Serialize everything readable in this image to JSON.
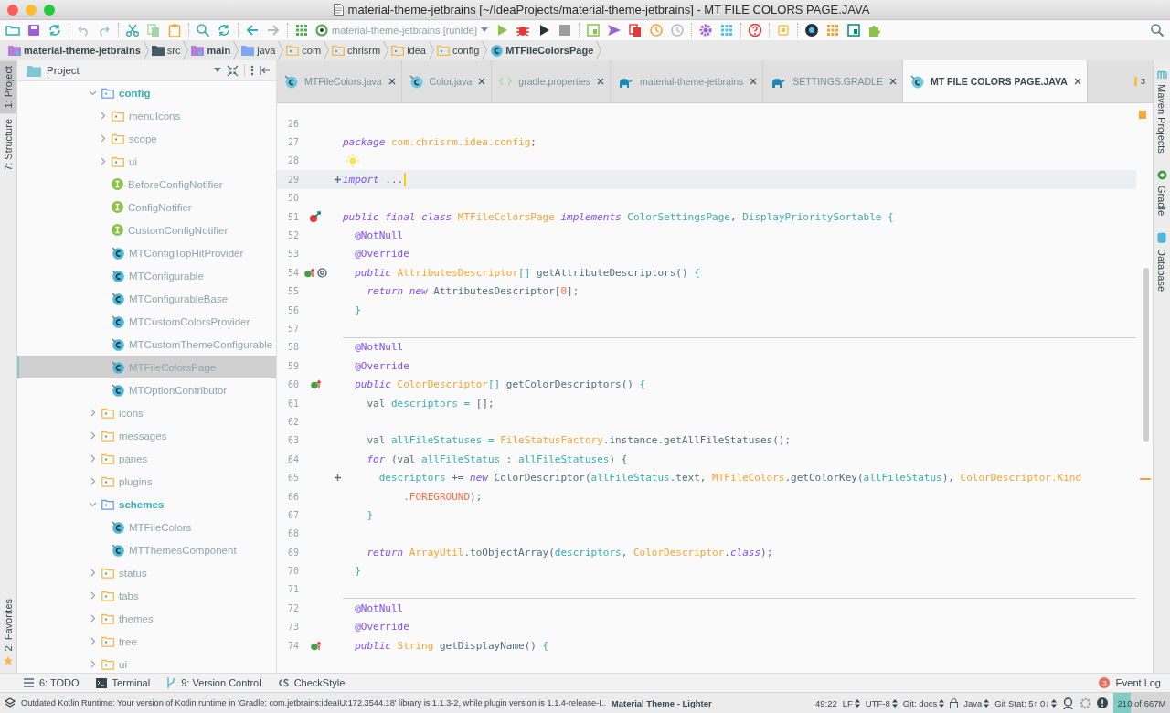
{
  "window": {
    "title": "material-theme-jetbrains [~/IdeaProjects/material-theme-jetbrains] - MT FILE COLORS PAGE.JAVA"
  },
  "toolbar": {
    "run_config": "material-theme-jetbrains [runIde]"
  },
  "breadcrumbs": [
    {
      "label": "material-theme-jetbrains",
      "kind": "module"
    },
    {
      "label": "src",
      "kind": "dir"
    },
    {
      "label": "main",
      "kind": "module"
    },
    {
      "label": "java",
      "kind": "source"
    },
    {
      "label": "com",
      "kind": "package"
    },
    {
      "label": "chrisrm",
      "kind": "package"
    },
    {
      "label": "idea",
      "kind": "package"
    },
    {
      "label": "config",
      "kind": "package"
    },
    {
      "label": "MTFileColorsPage",
      "kind": "class"
    }
  ],
  "left_tools_top": [
    {
      "label": "1: Project",
      "selected": true
    },
    {
      "label": "7: Structure",
      "selected": false
    }
  ],
  "left_tools_bottom": [
    {
      "label": "2: Favorites",
      "selected": false
    }
  ],
  "project_panel": {
    "title": "Project",
    "tree": [
      {
        "label": "config",
        "kind": "folder",
        "expanded": true,
        "selected": false,
        "children": [
          {
            "label": "menuIcons",
            "kind": "folder",
            "expanded": false,
            "selected": false
          },
          {
            "label": "scope",
            "kind": "folder",
            "expanded": false,
            "selected": false
          },
          {
            "label": "ui",
            "kind": "folder",
            "expanded": false,
            "selected": false
          },
          {
            "label": "BeforeConfigNotifier",
            "kind": "interface",
            "selected": false
          },
          {
            "label": "ConfigNotifier",
            "kind": "interface",
            "selected": false
          },
          {
            "label": "CustomConfigNotifier",
            "kind": "interface",
            "selected": false
          },
          {
            "label": "MTConfigTopHitProvider",
            "kind": "class",
            "selected": false
          },
          {
            "label": "MTConfigurable",
            "kind": "class",
            "selected": false
          },
          {
            "label": "MTConfigurableBase",
            "kind": "class",
            "selected": false
          },
          {
            "label": "MTCustomColorsProvider",
            "kind": "class",
            "selected": false
          },
          {
            "label": "MTCustomThemeConfigurable",
            "kind": "class",
            "selected": false
          },
          {
            "label": "MTFileColorsPage",
            "kind": "class",
            "selected": true
          },
          {
            "label": "MTOptionContributor",
            "kind": "class",
            "selected": false
          }
        ]
      },
      {
        "label": "icons",
        "kind": "folder",
        "expanded": false,
        "selected": false
      },
      {
        "label": "messages",
        "kind": "folder",
        "expanded": false,
        "selected": false
      },
      {
        "label": "panes",
        "kind": "folder",
        "expanded": false,
        "selected": false
      },
      {
        "label": "plugins",
        "kind": "folder",
        "expanded": false,
        "selected": false
      },
      {
        "label": "schemes",
        "kind": "folder",
        "expanded": true,
        "selected": false,
        "children": [
          {
            "label": "MTFileColors",
            "kind": "class",
            "selected": false
          },
          {
            "label": "MTThemesComponent",
            "kind": "class",
            "selected": false
          }
        ]
      },
      {
        "label": "status",
        "kind": "folder",
        "expanded": false,
        "selected": false
      },
      {
        "label": "tabs",
        "kind": "folder",
        "expanded": false,
        "selected": false
      },
      {
        "label": "themes",
        "kind": "folder",
        "expanded": false,
        "selected": false
      },
      {
        "label": "tree",
        "kind": "folder",
        "expanded": false,
        "selected": false
      },
      {
        "label": "ui",
        "kind": "folder",
        "expanded": false,
        "selected": false
      }
    ]
  },
  "tabs": [
    {
      "label": "MTFileColors.java",
      "kind": "class",
      "selected": false
    },
    {
      "label": "Color.java",
      "kind": "class",
      "selected": false
    },
    {
      "label": "gradle.properties",
      "kind": "properties",
      "selected": false
    },
    {
      "label": "material-theme-jetbrains",
      "kind": "gradle",
      "selected": false
    },
    {
      "label": "SETTINGS.GRADLE",
      "kind": "gradle",
      "selected": false
    },
    {
      "label": "MT FILE COLORS PAGE.JAVA",
      "kind": "class",
      "selected": true
    }
  ],
  "inspection_count": "3",
  "right_tools": [
    "Maven Projects",
    "Gradle",
    "Database"
  ],
  "code_lines": [
    {
      "number": "26",
      "kind": "plain"
    },
    {
      "number": "27",
      "kind": "plain",
      "tokens": [
        {
          "text": "package ",
          "kind": "keyword"
        },
        {
          "text": "com.chrisrm.idea.config",
          "kind": "type"
        },
        {
          "text": ";",
          "kind": "plain"
        }
      ]
    },
    {
      "number": "28",
      "kind": "bulb"
    },
    {
      "number": "29",
      "kind": "plain",
      "current": true,
      "fold": true,
      "tokens": [
        {
          "text": "import",
          "kind": "keyword"
        },
        {
          "text": " ...",
          "kind": "plain"
        }
      ]
    },
    {
      "number": "50",
      "kind": "plain"
    },
    {
      "number": "51",
      "kind": "class-marker",
      "tokens": [
        {
          "text": "public final class ",
          "kind": "keyword"
        },
        {
          "text": "MTFileColorsPage ",
          "kind": "type"
        },
        {
          "text": "implements ",
          "kind": "keyword"
        },
        {
          "text": "ColorSettingsPage",
          "kind": "variable"
        },
        {
          "text": ", ",
          "kind": "plain"
        },
        {
          "text": "DisplayPrioritySortable {",
          "kind": "variable"
        }
      ]
    },
    {
      "number": "52",
      "kind": "plain",
      "tokens": [
        {
          "text": "  @NotNull",
          "kind": "annotation"
        }
      ]
    },
    {
      "number": "53",
      "kind": "plain",
      "tokens": [
        {
          "text": "  @Override",
          "kind": "annotation"
        }
      ]
    },
    {
      "number": "54",
      "kind": "override-annotated",
      "tokens": [
        {
          "text": "  public ",
          "kind": "keyword"
        },
        {
          "text": "AttributesDescriptor",
          "kind": "type"
        },
        {
          "text": "[]",
          "kind": "variable"
        },
        {
          "text": " getAttributeDescriptors() ",
          "kind": "plain"
        },
        {
          "text": "{",
          "kind": "variable"
        }
      ]
    },
    {
      "number": "55",
      "kind": "plain",
      "tokens": [
        {
          "text": "    return new",
          "kind": "keyword"
        },
        {
          "text": " AttributesDescriptor[",
          "kind": "plain"
        },
        {
          "text": "0",
          "kind": "number"
        },
        {
          "text": "];",
          "kind": "plain"
        }
      ]
    },
    {
      "number": "56",
      "kind": "plain",
      "tokens": [
        {
          "text": "  }",
          "kind": "variable"
        }
      ]
    },
    {
      "number": "57",
      "kind": "plain"
    },
    {
      "number": "58",
      "kind": "plain",
      "separator": true,
      "tokens": [
        {
          "text": "  @NotNull",
          "kind": "annotation"
        }
      ]
    },
    {
      "number": "59",
      "kind": "plain",
      "tokens": [
        {
          "text": "  @Override",
          "kind": "annotation"
        }
      ]
    },
    {
      "number": "60",
      "kind": "override",
      "tokens": [
        {
          "text": "  public ",
          "kind": "keyword"
        },
        {
          "text": "ColorDescriptor",
          "kind": "type"
        },
        {
          "text": "[]",
          "kind": "variable"
        },
        {
          "text": " getColorDescriptors() ",
          "kind": "plain"
        },
        {
          "text": "{",
          "kind": "variable"
        }
      ]
    },
    {
      "number": "61",
      "kind": "plain",
      "tokens": [
        {
          "text": "    val ",
          "kind": "plain"
        },
        {
          "text": "descriptors = ",
          "kind": "variable"
        },
        {
          "text": "[];",
          "kind": "plain"
        }
      ]
    },
    {
      "number": "62",
      "kind": "plain"
    },
    {
      "number": "63",
      "kind": "plain",
      "tokens": [
        {
          "text": "    val ",
          "kind": "plain"
        },
        {
          "text": "allFileStatuses = ",
          "kind": "variable"
        },
        {
          "text": "FileStatusFactory",
          "kind": "type"
        },
        {
          "text": ".instance.getAllFileStatuses();",
          "kind": "plain"
        }
      ]
    },
    {
      "number": "64",
      "kind": "plain",
      "tokens": [
        {
          "text": "    for",
          "kind": "keyword"
        },
        {
          "text": " (val ",
          "kind": "plain"
        },
        {
          "text": "allFileStatus",
          "kind": "variable"
        },
        {
          "text": " : ",
          "kind": "plain"
        },
        {
          "text": "allFileStatuses",
          "kind": "variable"
        },
        {
          "text": ") {",
          "kind": "plain"
        }
      ]
    },
    {
      "number": "65",
      "kind": "plain",
      "fold": true,
      "tokens": [
        {
          "text": "      descriptors",
          "kind": "variable"
        },
        {
          "text": " += ",
          "kind": "plain"
        },
        {
          "text": "new",
          "kind": "keyword"
        },
        {
          "text": " ColorDescriptor(",
          "kind": "plain"
        },
        {
          "text": "allFileStatus",
          "kind": "variable"
        },
        {
          "text": ".text, ",
          "kind": "plain"
        },
        {
          "text": "MTFileColors",
          "kind": "type"
        },
        {
          "text": ".getColorKey(",
          "kind": "plain"
        },
        {
          "text": "allFileStatus",
          "kind": "variable"
        },
        {
          "text": "), ",
          "kind": "plain"
        },
        {
          "text": "ColorDescriptor.Kind",
          "kind": "type"
        }
      ]
    },
    {
      "number": "66",
      "kind": "plain",
      "tokens": [
        {
          "text": "          .FOREGROUND",
          "kind": "number"
        },
        {
          "text": ");",
          "kind": "plain"
        }
      ]
    },
    {
      "number": "67",
      "kind": "plain",
      "tokens": [
        {
          "text": "    }",
          "kind": "variable"
        }
      ]
    },
    {
      "number": "68",
      "kind": "plain"
    },
    {
      "number": "69",
      "kind": "plain",
      "tokens": [
        {
          "text": "    return ",
          "kind": "keyword"
        },
        {
          "text": "ArrayUtil",
          "kind": "type"
        },
        {
          "text": ".toObjectArray(",
          "kind": "plain"
        },
        {
          "text": "descriptors",
          "kind": "variable"
        },
        {
          "text": ", ",
          "kind": "plain"
        },
        {
          "text": "ColorDescriptor",
          "kind": "type"
        },
        {
          "text": ".",
          "kind": "plain"
        },
        {
          "text": "class",
          "kind": "keyword"
        },
        {
          "text": ");",
          "kind": "plain"
        }
      ]
    },
    {
      "number": "70",
      "kind": "plain",
      "tokens": [
        {
          "text": "  }",
          "kind": "variable"
        }
      ]
    },
    {
      "number": "71",
      "kind": "plain"
    },
    {
      "number": "72",
      "kind": "plain",
      "separator": true,
      "tokens": [
        {
          "text": "  @NotNull",
          "kind": "annotation"
        }
      ]
    },
    {
      "number": "73",
      "kind": "plain",
      "tokens": [
        {
          "text": "  @Override",
          "kind": "annotation"
        }
      ]
    },
    {
      "number": "74",
      "kind": "override",
      "tokens": [
        {
          "text": "  public ",
          "kind": "keyword"
        },
        {
          "text": "String",
          "kind": "type"
        },
        {
          "text": " getDisplayName() ",
          "kind": "plain"
        },
        {
          "text": "{",
          "kind": "variable"
        }
      ]
    }
  ],
  "bottom_tools": [
    {
      "label": "6: TODO",
      "kind": "todo"
    },
    {
      "label": "Terminal",
      "kind": "terminal"
    },
    {
      "label": "9: Version Control",
      "kind": "vcs"
    },
    {
      "label": "CheckStyle",
      "kind": "checkstyle"
    }
  ],
  "event_log": {
    "label": "Event Log",
    "badge": "3"
  },
  "status_bar": {
    "message": "Outdated Kotlin Runtime: Your version of Kotlin runtime in 'Gradle: com.jetbrains:ideaIU:172.3544.18' library is 1.1.3-2, while plugin version is 1.1.4-release-I..",
    "theme": "Material Theme - Lighter",
    "items": [
      {
        "label": "49:22",
        "dropdown": false
      },
      {
        "label": "LF",
        "dropdown": true
      },
      {
        "label": "UTF-8",
        "dropdown": true
      },
      {
        "label": "Git: docs",
        "dropdown": true
      },
      {
        "label": "Java",
        "dropdown": true
      },
      {
        "label": "Git Stat: 5↑ 0↓",
        "dropdown": true
      }
    ],
    "memory": {
      "label": "210 of 667M",
      "level": 0.31
    }
  }
}
